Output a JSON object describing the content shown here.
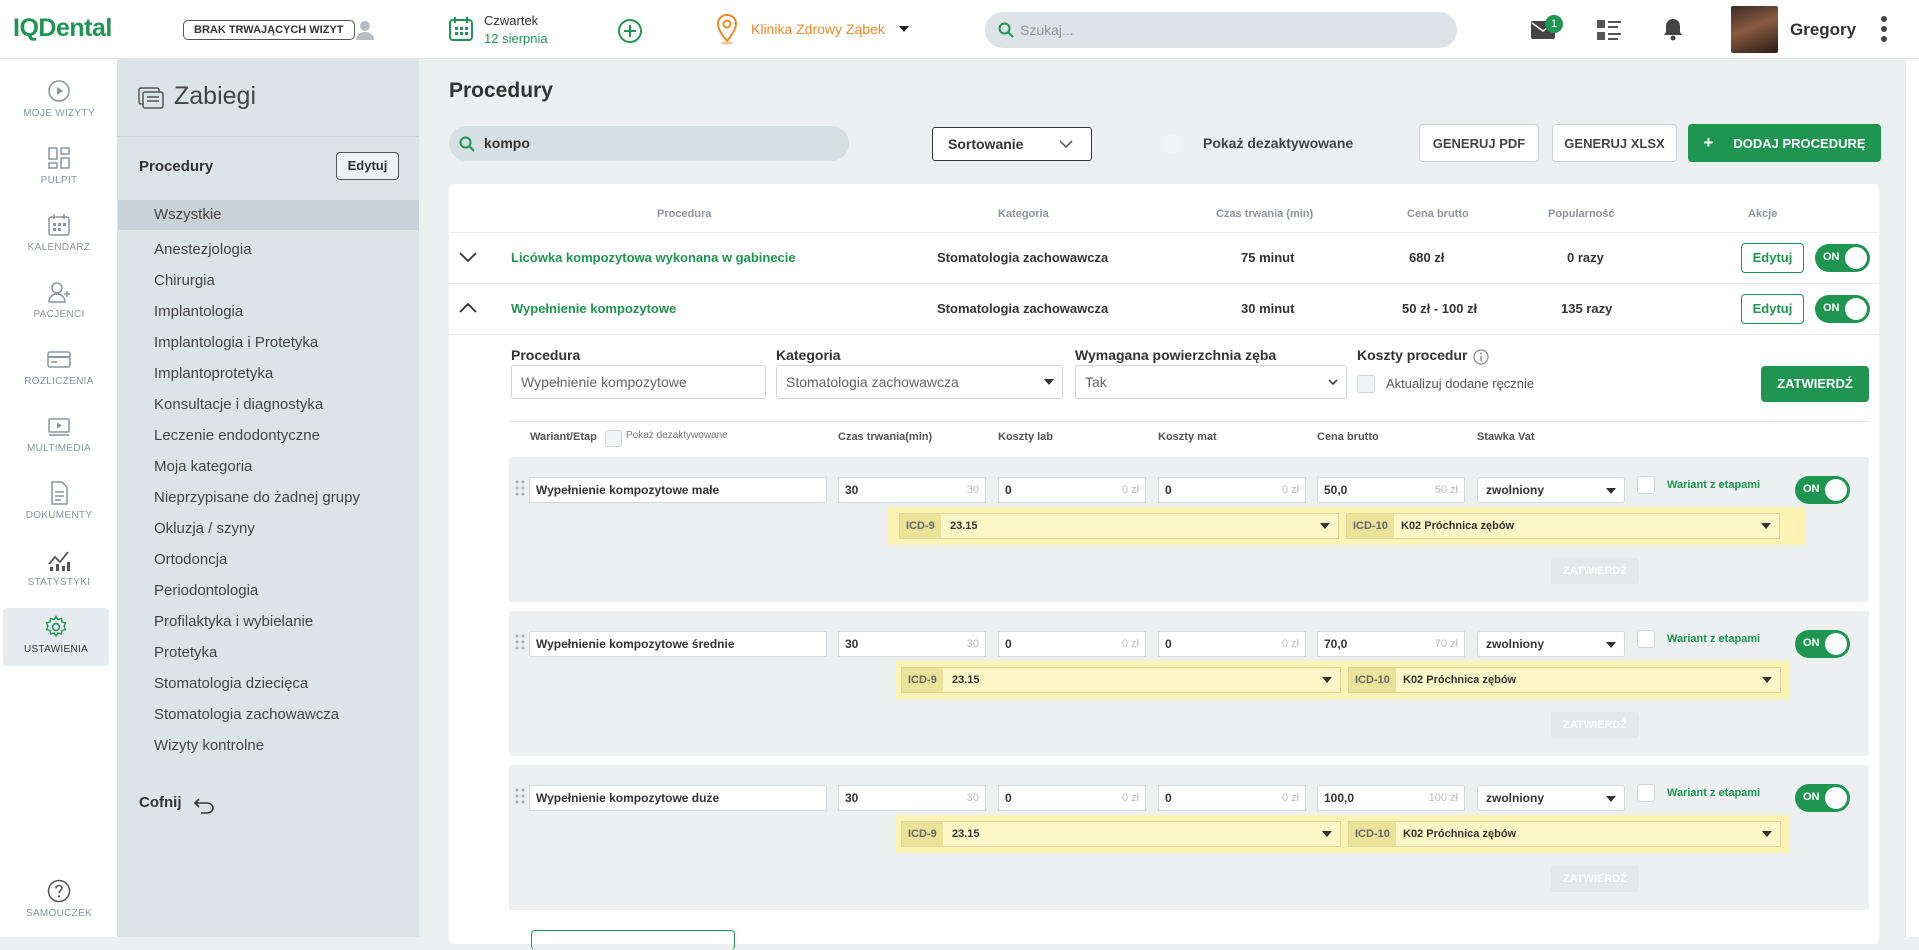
{
  "topbar": {
    "logo": "IQDental",
    "no_visits": "BRAK TRWAJĄCYCH WIZYT",
    "date_day": "Czwartek",
    "date_date": "12 sierpnia",
    "clinic": "Klinika Zdrowy Ząbek",
    "search_placeholder": "Szukaj...",
    "mail_badge": "1",
    "user_name": "Gregory"
  },
  "nav": [
    {
      "label": "MOJE WIZYTY",
      "icon": "play-circle-icon"
    },
    {
      "label": "PULPIT",
      "icon": "dashboard-icon"
    },
    {
      "label": "KALENDARZ",
      "icon": "calendar-icon"
    },
    {
      "label": "PACJENCI",
      "icon": "patients-icon"
    },
    {
      "label": "ROZLICZENIA",
      "icon": "card-icon"
    },
    {
      "label": "MULTIMEDIA",
      "icon": "media-icon"
    },
    {
      "label": "DOKUMENTY",
      "icon": "document-icon"
    },
    {
      "label": "STATYSTYKI",
      "icon": "stats-icon"
    },
    {
      "label": "USTAWIENIA",
      "icon": "gear-icon"
    }
  ],
  "nav_help": "SAMOUCZEK",
  "categories": {
    "title": "Zabiegi",
    "header": "Procedury",
    "edit": "Edytuj",
    "all": "Wszystkie",
    "items": [
      "Anestezjologia",
      "Chirurgia",
      "Implantologia",
      "Implantologia i Protetyka",
      "Implantoprotetyka",
      "Konsultacje i diagnostyka",
      "Leczenie endodontyczne",
      "Moja kategoria",
      "Nieprzypisane do żadnej grupy",
      "Okluzja / szyny",
      "Ortodoncja",
      "Periodontologia",
      "Profilaktyka i wybielanie",
      "Protetyka",
      "Stomatologia dziecięca",
      "Stomatologia zachowawcza",
      "Wizyty kontrolne"
    ],
    "back": "Cofnij"
  },
  "main": {
    "title": "Procedury",
    "search_value": "kompo",
    "sort": "Sortowanie",
    "show_deactivated": "Pokaż dezaktywowane",
    "pdf": "GENERUJ PDF",
    "xlsx": "GENERUJ XLSX",
    "add": "DODAJ PROCEDURĘ"
  },
  "table": {
    "headers": [
      "Procedura",
      "Kategoria",
      "Czas trwania (min)",
      "Cena brutto",
      "Popularność",
      "Akcje"
    ],
    "rows": [
      {
        "name": "Licówka kompozytowa wykonana w gabinecie",
        "category": "Stomatologia zachowawcza",
        "duration": "75 minut",
        "price": "680 zł",
        "popularity": "0 razy",
        "edit": "Edytuj",
        "toggle": "ON"
      },
      {
        "name": "Wypełnienie kompozytowe",
        "category": "Stomatologia zachowawcza",
        "duration": "30 minut",
        "price": "50 zł - 100 zł",
        "popularity": "135 razy",
        "edit": "Edytuj",
        "toggle": "ON"
      }
    ]
  },
  "form": {
    "proc_label": "Procedura",
    "proc_placeholder": "Wypełnienie kompozytowe",
    "cat_label": "Kategoria",
    "cat_value": "Stomatologia zachowawcza",
    "surface_label": "Wymagana powierzchnia zęba",
    "surface_value": "Tak",
    "costs_label": "Koszty procedur",
    "manual_label": "Aktualizuj dodane ręcznie",
    "confirm": "ZATWIERDŹ"
  },
  "variants_header": {
    "variant": "Wariant/Etap",
    "show_deact": "Pokaż dezaktywowane",
    "duration": "Czas trwania(min)",
    "lab": "Koszty lab",
    "mat": "Koszty mat",
    "price": "Cena brutto",
    "vat": "Stawka Vat"
  },
  "variants": [
    {
      "name": "Wypełnienie kompozytowe małe",
      "duration": "30",
      "duration_ph": "30",
      "lab": "0",
      "lab_ph": "0 zł",
      "mat": "0",
      "mat_ph": "0 zł",
      "price": "50,0",
      "price_ph": "50 zł",
      "vat": "zwolniony",
      "stages": "Wariant z etapami",
      "toggle": "ON",
      "icd9_label": "ICD-9",
      "icd9": "23.15",
      "icd10_label": "ICD-10",
      "icd10": "K02 Próchnica zębów",
      "confirm": "ZATWIERDŹ"
    },
    {
      "name": "Wypełnienie kompozytowe średnie",
      "duration": "30",
      "duration_ph": "30",
      "lab": "0",
      "lab_ph": "0 zł",
      "mat": "0",
      "mat_ph": "0 zł",
      "price": "70,0",
      "price_ph": "70 zł",
      "vat": "zwolniony",
      "stages": "Wariant z etapami",
      "toggle": "ON",
      "icd9_label": "ICD-9",
      "icd9": "23.15",
      "icd10_label": "ICD-10",
      "icd10": "K02 Próchnica zębów",
      "confirm": "ZATWIERDŹ"
    },
    {
      "name": "Wypełnienie kompozytowe duże",
      "duration": "30",
      "duration_ph": "30",
      "lab": "0",
      "lab_ph": "0 zł",
      "mat": "0",
      "mat_ph": "0 zł",
      "price": "100,0",
      "price_ph": "100 zł",
      "vat": "zwolniony",
      "stages": "Wariant z etapami",
      "toggle": "ON",
      "icd9_label": "ICD-9",
      "icd9": "23.15",
      "icd10_label": "ICD-10",
      "icd10": "K02 Próchnica zębów",
      "confirm": "ZATWIERDŹ"
    }
  ],
  "colors": {
    "brand": "#1e9550",
    "clinic": "#f08a24",
    "icd_bg": "#fbf4b4"
  }
}
